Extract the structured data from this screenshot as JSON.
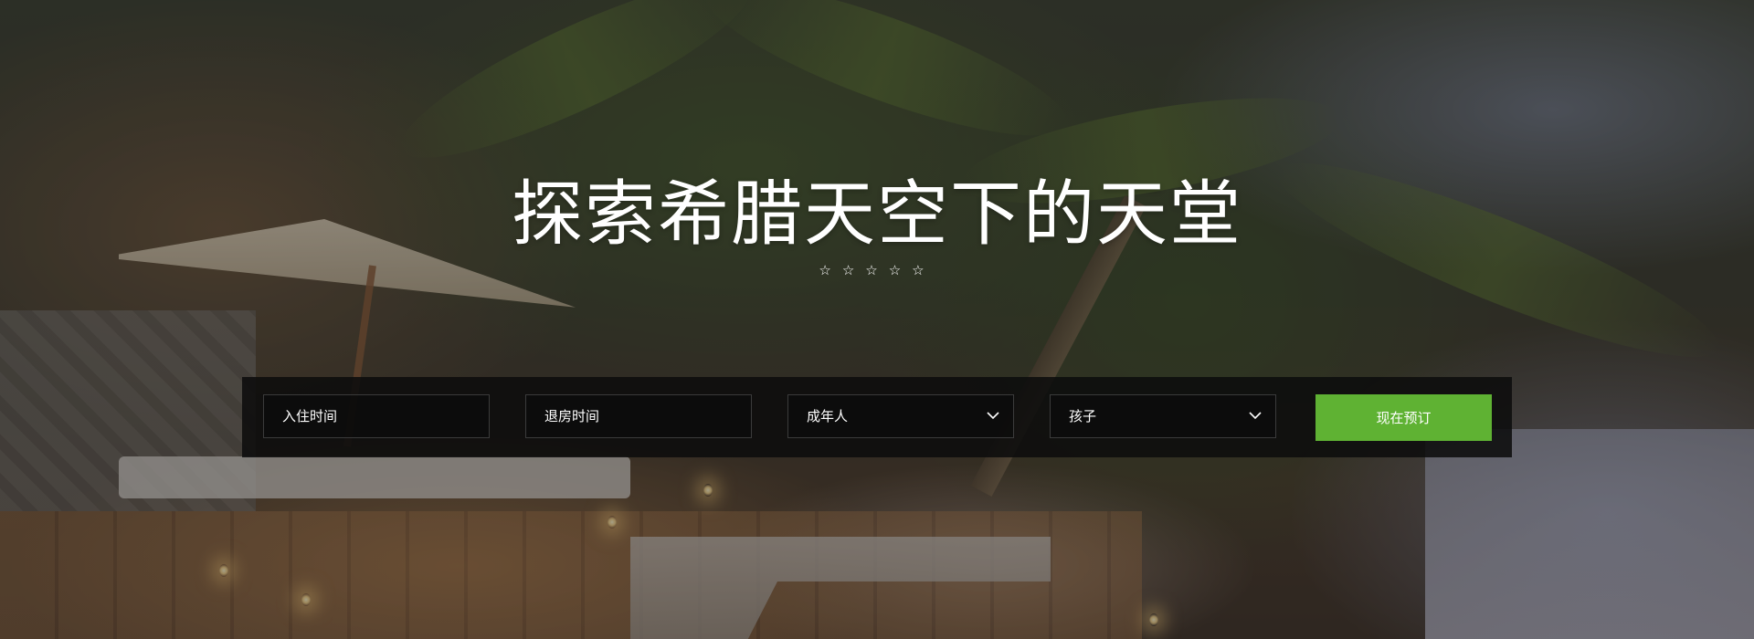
{
  "hero": {
    "headline": "探索希腊天空下的天堂",
    "rating_stars": "☆☆☆☆☆"
  },
  "booking": {
    "check_in_label": "入住时间",
    "check_out_label": "退房时间",
    "adults_label": "成年人",
    "children_label": "孩子",
    "submit_label": "现在预订"
  },
  "colors": {
    "accent_button": "#5fb233",
    "bar_background": "#0c0c0c",
    "text": "#ffffff"
  },
  "icons": {
    "dropdown": "chevron-down-icon",
    "rating": "star-outline-icon"
  }
}
